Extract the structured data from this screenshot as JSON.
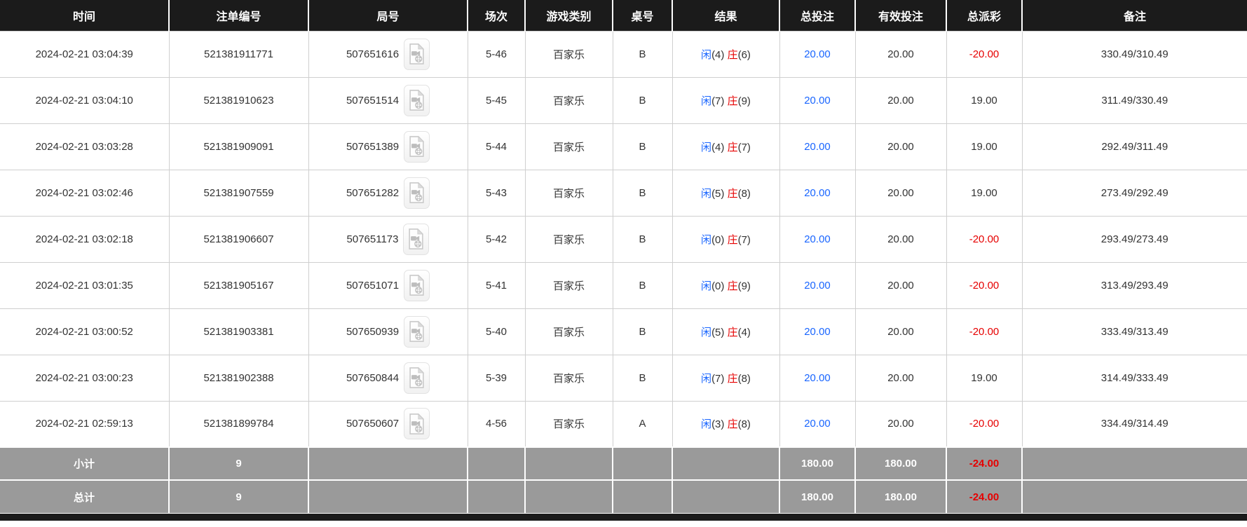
{
  "colors": {
    "header_bg": "#1b1b1b",
    "footer_bg": "#9a9a9a",
    "bet_blue": "#1a66ff",
    "loss_red": "#e60000"
  },
  "table": {
    "columns": [
      "时间",
      "注单编号",
      "局号",
      "场次",
      "游戏类别",
      "桌号",
      "结果",
      "总投注",
      "有效投注",
      "总派彩",
      "备注"
    ]
  },
  "icons": {
    "video": "video-file-icon"
  },
  "rows": [
    {
      "time": "2024-02-21 03:04:39",
      "bet_no": "521381911771",
      "round_no": "507651616",
      "session": "5-46",
      "game_type": "百家乐",
      "table_no": "B",
      "result": {
        "player_label": "闲",
        "player_score": "(4)",
        "banker_label": "庄",
        "banker_score": "(6)"
      },
      "total_bet": "20.00",
      "valid_bet": "20.00",
      "payout": "-20.00",
      "remark": "330.49/310.49"
    },
    {
      "time": "2024-02-21 03:04:10",
      "bet_no": "521381910623",
      "round_no": "507651514",
      "session": "5-45",
      "game_type": "百家乐",
      "table_no": "B",
      "result": {
        "player_label": "闲",
        "player_score": "(7)",
        "banker_label": "庄",
        "banker_score": "(9)"
      },
      "total_bet": "20.00",
      "valid_bet": "20.00",
      "payout": "19.00",
      "remark": "311.49/330.49"
    },
    {
      "time": "2024-02-21 03:03:28",
      "bet_no": "521381909091",
      "round_no": "507651389",
      "session": "5-44",
      "game_type": "百家乐",
      "table_no": "B",
      "result": {
        "player_label": "闲",
        "player_score": "(4)",
        "banker_label": "庄",
        "banker_score": "(7)"
      },
      "total_bet": "20.00",
      "valid_bet": "20.00",
      "payout": "19.00",
      "remark": "292.49/311.49"
    },
    {
      "time": "2024-02-21 03:02:46",
      "bet_no": "521381907559",
      "round_no": "507651282",
      "session": "5-43",
      "game_type": "百家乐",
      "table_no": "B",
      "result": {
        "player_label": "闲",
        "player_score": "(5)",
        "banker_label": "庄",
        "banker_score": "(8)"
      },
      "total_bet": "20.00",
      "valid_bet": "20.00",
      "payout": "19.00",
      "remark": "273.49/292.49"
    },
    {
      "time": "2024-02-21 03:02:18",
      "bet_no": "521381906607",
      "round_no": "507651173",
      "session": "5-42",
      "game_type": "百家乐",
      "table_no": "B",
      "result": {
        "player_label": "闲",
        "player_score": "(0)",
        "banker_label": "庄",
        "banker_score": "(7)"
      },
      "total_bet": "20.00",
      "valid_bet": "20.00",
      "payout": "-20.00",
      "remark": "293.49/273.49"
    },
    {
      "time": "2024-02-21 03:01:35",
      "bet_no": "521381905167",
      "round_no": "507651071",
      "session": "5-41",
      "game_type": "百家乐",
      "table_no": "B",
      "result": {
        "player_label": "闲",
        "player_score": "(0)",
        "banker_label": "庄",
        "banker_score": "(9)"
      },
      "total_bet": "20.00",
      "valid_bet": "20.00",
      "payout": "-20.00",
      "remark": "313.49/293.49"
    },
    {
      "time": "2024-02-21 03:00:52",
      "bet_no": "521381903381",
      "round_no": "507650939",
      "session": "5-40",
      "game_type": "百家乐",
      "table_no": "B",
      "result": {
        "player_label": "闲",
        "player_score": "(5)",
        "banker_label": "庄",
        "banker_score": "(4)"
      },
      "total_bet": "20.00",
      "valid_bet": "20.00",
      "payout": "-20.00",
      "remark": "333.49/313.49"
    },
    {
      "time": "2024-02-21 03:00:23",
      "bet_no": "521381902388",
      "round_no": "507650844",
      "session": "5-39",
      "game_type": "百家乐",
      "table_no": "B",
      "result": {
        "player_label": "闲",
        "player_score": "(7)",
        "banker_label": "庄",
        "banker_score": "(8)"
      },
      "total_bet": "20.00",
      "valid_bet": "20.00",
      "payout": "19.00",
      "remark": "314.49/333.49"
    },
    {
      "time": "2024-02-21 02:59:13",
      "bet_no": "521381899784",
      "round_no": "507650607",
      "session": "4-56",
      "game_type": "百家乐",
      "table_no": "A",
      "result": {
        "player_label": "闲",
        "player_score": "(3)",
        "banker_label": "庄",
        "banker_score": "(8)"
      },
      "total_bet": "20.00",
      "valid_bet": "20.00",
      "payout": "-20.00",
      "remark": "334.49/314.49"
    }
  ],
  "footer": {
    "subtotal": {
      "label": "小计",
      "count": "9",
      "total_bet": "180.00",
      "valid_bet": "180.00",
      "payout": "-24.00"
    },
    "total": {
      "label": "总计",
      "count": "9",
      "total_bet": "180.00",
      "valid_bet": "180.00",
      "payout": "-24.00"
    }
  }
}
